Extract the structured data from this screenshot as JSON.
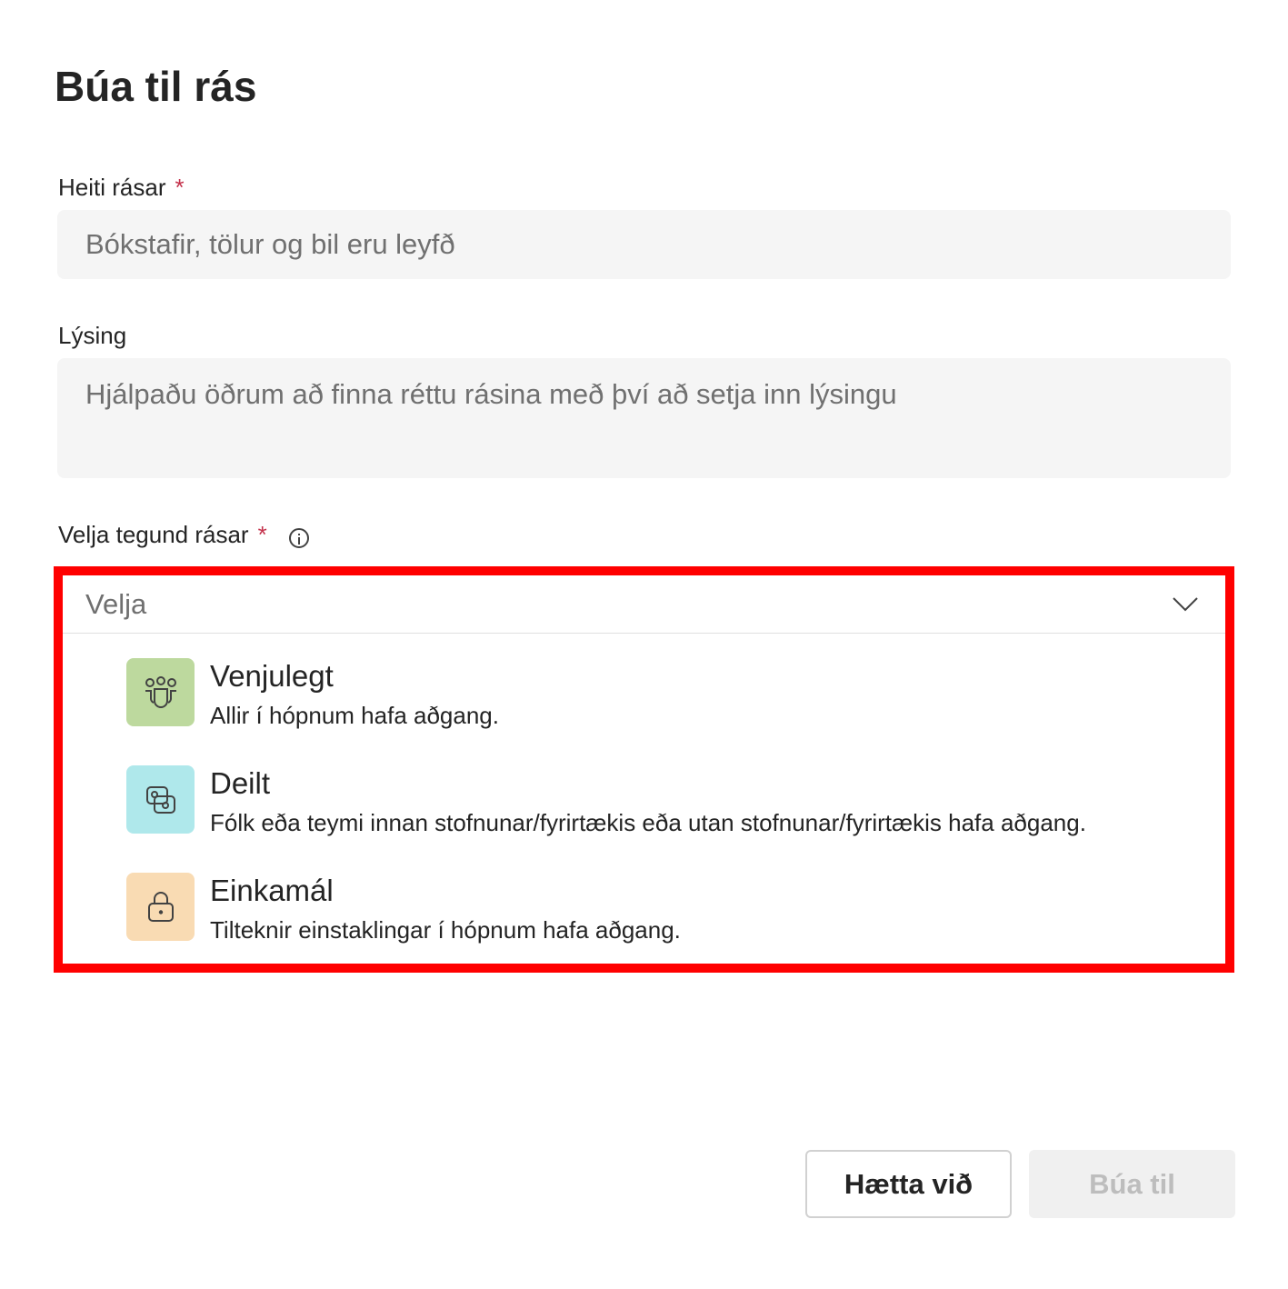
{
  "dialog": {
    "title": "Búa til rás"
  },
  "name_field": {
    "label": "Heiti rásar",
    "required_mark": "*",
    "placeholder": "Bókstafir, tölur og bil eru leyfð"
  },
  "description_field": {
    "label": "Lýsing",
    "placeholder": "Hjálpaðu öðrum að finna réttu rásina með því að setja inn lýsingu"
  },
  "type_field": {
    "label": "Velja tegund rásar",
    "required_mark": "*",
    "select_placeholder": "Velja",
    "options": [
      {
        "title": "Venjulegt",
        "description": "Allir í hópnum hafa aðgang.",
        "icon": "people-team-icon",
        "icon_bg": "#bdd99e"
      },
      {
        "title": "Deilt",
        "description": "Fólk eða teymi innan stofnunar/fyrirtækis eða utan stofnunar/fyrirtækis hafa aðgang.",
        "icon": "shared-channel-icon",
        "icon_bg": "#afe8eb"
      },
      {
        "title": "Einkamál",
        "description": "Tilteknir einstaklingar í hópnum hafa aðgang.",
        "icon": "lock-icon",
        "icon_bg": "#f9dbb3"
      }
    ]
  },
  "buttons": {
    "cancel": "Hætta við",
    "create": "Búa til"
  },
  "colors": {
    "highlight_border": "#ff0000",
    "required": "#c4314b"
  }
}
